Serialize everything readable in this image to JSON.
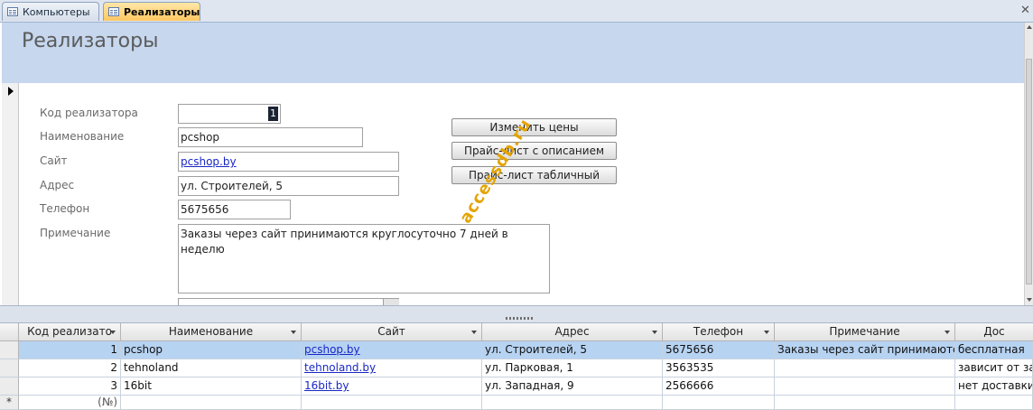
{
  "tabs": [
    {
      "label": "Компьютеры",
      "active": false
    },
    {
      "label": "Реализаторы",
      "active": true
    }
  ],
  "form": {
    "title": "Реализаторы",
    "fields": {
      "id": {
        "label": "Код реализатора",
        "value": "1"
      },
      "name": {
        "label": "Наименование",
        "value": "pcshop"
      },
      "site": {
        "label": "Сайт",
        "value": "pcshop.by"
      },
      "address": {
        "label": "Адрес",
        "value": "ул. Строителей, 5"
      },
      "phone": {
        "label": "Телефон",
        "value": "5675656"
      },
      "note": {
        "label": "Примечание",
        "value": "Заказы через сайт принимаются круглосуточно 7 дней в неделю"
      }
    },
    "buttons": {
      "change_prices": "Изменить цены",
      "price_desc": "Прайс-лист с описанием",
      "price_table": "Прайс-лист табличный"
    }
  },
  "watermark": "accessdb.ru",
  "datasheet": {
    "columns": [
      "Код реализато",
      "Наименование",
      "Сайт",
      "Адрес",
      "Телефон",
      "Примечание",
      "Дос"
    ],
    "rows": [
      [
        "1",
        "pcshop",
        "pcshop.by",
        "ул. Строителей, 5",
        "5675656",
        "Заказы через сайт принимаются",
        "бесплатная"
      ],
      [
        "2",
        "tehnoland",
        "tehnoland.by",
        "ул. Парковая, 1",
        "3563535",
        "",
        "зависит от за"
      ],
      [
        "3",
        "16bit",
        "16bit.by",
        "ул. Западная, 9",
        "2566666",
        "",
        "нет доставки"
      ]
    ],
    "new_row_marker": "*",
    "new_row_id": "(№)"
  },
  "colors": {
    "header_band": "#c6d7ee",
    "active_tab": "#ffc761",
    "selected_row": "#b7d3f2",
    "link": "#1a28c4"
  }
}
